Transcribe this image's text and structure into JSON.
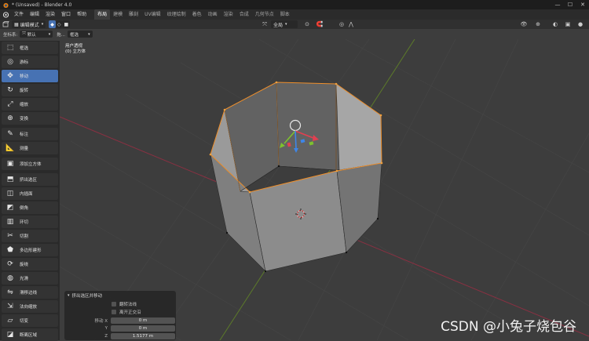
{
  "window": {
    "title": "* (Unsaved) - Blender 4.0"
  },
  "menu": {
    "items": [
      "文件",
      "编辑",
      "渲染",
      "窗口",
      "帮助"
    ]
  },
  "workspaces": [
    "布局",
    "建模",
    "雕刻",
    "UV编辑",
    "纹理绘制",
    "着色",
    "动画",
    "渲染",
    "合成",
    "几何节点",
    "脚本"
  ],
  "header": {
    "mode": "编辑模式",
    "view_menu": [
      "视图",
      "选择",
      "添加",
      "网格",
      "顶点",
      "边",
      "面",
      "UV"
    ],
    "transform_orient": "全局"
  },
  "header2": {
    "coord_label": "坐标系:",
    "coord_value": "默认",
    "drag_label": "拖...",
    "drag_value": "框选"
  },
  "viewport": {
    "view_name": "用户透视",
    "object_name": "(0) 立方体"
  },
  "tools": [
    {
      "label": "框选",
      "icon": "select-box-icon",
      "active": false
    },
    {
      "label": "游标",
      "icon": "cursor-icon",
      "active": false
    },
    {
      "label": "移动",
      "icon": "move-icon",
      "active": true
    },
    {
      "label": "旋转",
      "icon": "rotate-icon",
      "active": false
    },
    {
      "label": "缩放",
      "icon": "scale-icon",
      "active": false
    },
    {
      "label": "变换",
      "icon": "transform-icon",
      "active": false
    },
    {
      "label": "标注",
      "icon": "annotate-icon",
      "active": false
    },
    {
      "label": "测量",
      "icon": "measure-icon",
      "active": false
    },
    {
      "label": "添加立方体",
      "icon": "add-cube-icon",
      "active": false
    },
    {
      "label": "挤出选区",
      "icon": "extrude-icon",
      "active": false
    },
    {
      "label": "内插面",
      "icon": "inset-icon",
      "active": false
    },
    {
      "label": "倒角",
      "icon": "bevel-icon",
      "active": false
    },
    {
      "label": "环切",
      "icon": "loop-cut-icon",
      "active": false
    },
    {
      "label": "切割",
      "icon": "knife-icon",
      "active": false
    },
    {
      "label": "多边形建形",
      "icon": "poly-build-icon",
      "active": false
    },
    {
      "label": "旋绕",
      "icon": "spin-icon",
      "active": false
    },
    {
      "label": "光滑",
      "icon": "smooth-icon",
      "active": false
    },
    {
      "label": "滑移边线",
      "icon": "edge-slide-icon",
      "active": false
    },
    {
      "label": "法向缩放",
      "icon": "shrink-fatten-icon",
      "active": false
    },
    {
      "label": "切变",
      "icon": "shear-icon",
      "active": false
    },
    {
      "label": "断离区域",
      "icon": "rip-region-icon",
      "active": false
    }
  ],
  "operator_panel": {
    "title": "挤出选区并移动",
    "checks": [
      "翻转法线",
      "离开正交沿"
    ],
    "fields": [
      {
        "label": "移动 X",
        "value": "0 m"
      },
      {
        "label": "Y",
        "value": "0 m"
      },
      {
        "label": "Z",
        "value": "1.5177 m"
      }
    ]
  },
  "watermark": "CSDN @小兔子烧包谷",
  "colors": {
    "accent": "#4772b3",
    "selection": "#f0902c",
    "x_axis": "#b5334a",
    "y_axis": "#6a9a2f"
  }
}
